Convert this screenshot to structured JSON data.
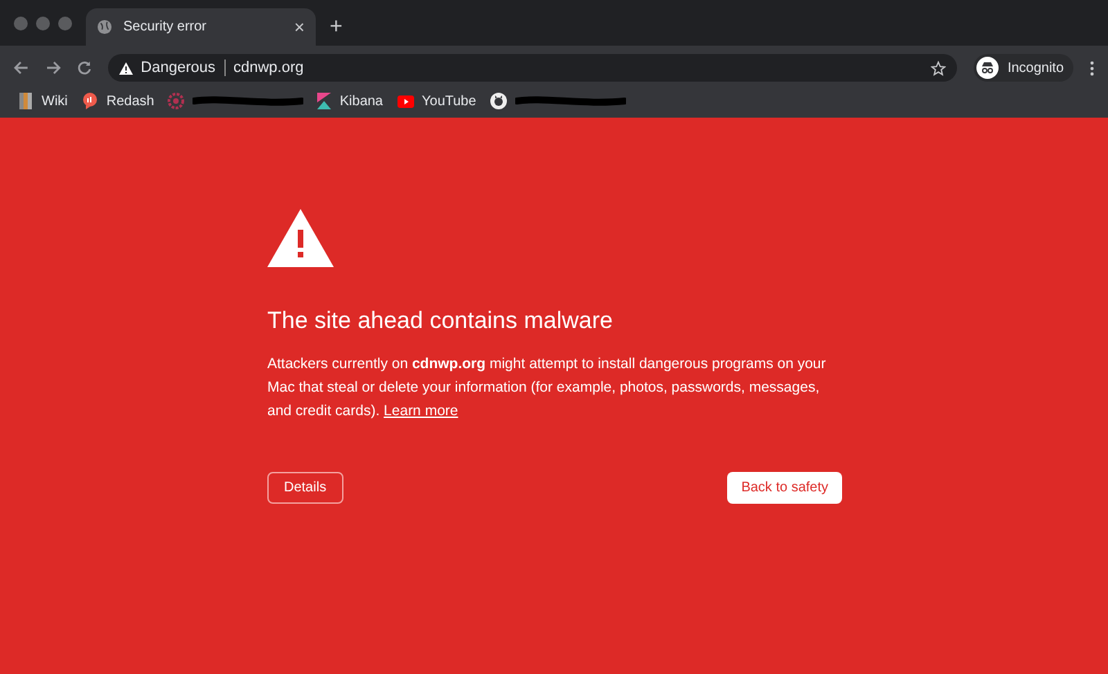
{
  "tab": {
    "title": "Security error",
    "close": "×"
  },
  "new_tab": "+",
  "address_bar": {
    "security_label": "Dangerous",
    "url": "cdnwp.org"
  },
  "profile": {
    "label": "Incognito"
  },
  "bookmarks": [
    {
      "kind": "wiki",
      "label": "Wiki"
    },
    {
      "kind": "redash",
      "label": "Redash"
    },
    {
      "kind": "redacted"
    },
    {
      "kind": "kibana",
      "label": "Kibana"
    },
    {
      "kind": "youtube",
      "label": "YouTube"
    },
    {
      "kind": "github"
    }
  ],
  "warning": {
    "title": "The site ahead contains malware",
    "message": "Attackers currently on **cdnwp.org** might attempt to install dangerous programs on your Mac that steal or delete your information (for example, photos, passwords, messages, and credit cards).",
    "link": "Learn more",
    "details_button": "Details",
    "back_button": "Back to safety"
  }
}
